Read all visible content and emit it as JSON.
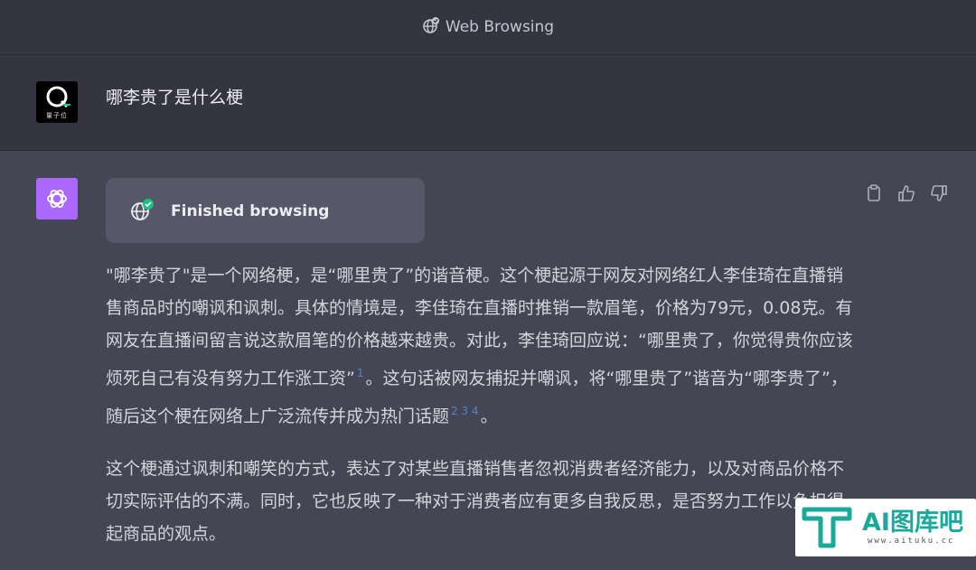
{
  "header": {
    "title": "Web Browsing",
    "icon": "globe-plugin-icon"
  },
  "user_message": {
    "avatar_caption": "量子位",
    "text": "哪李贵了是什么梗"
  },
  "assistant": {
    "browse_status": "Finished browsing",
    "actions": [
      "copy-icon",
      "thumbs-up-icon",
      "thumbs-down-icon"
    ],
    "p1": {
      "a": "\"哪李贵了\"是一个网络梗，是“哪里贵了”的谐音梗。这个梗起源于网友对网络红人李佳琦在直播销售商品时的嘲讽和讽刺。具体的情境是，李佳琦在直播时推销一款眉笔，价格为79元，0.08克。有网友在直播间留言说这款眉笔的价格越来越贵。对此，李佳琦回应说：“哪里贵了，你觉得贵你应该烦死自己有没有努力工作涨工资”",
      "ref1": "1",
      "b": "。这句话被网友捕捉并嘲讽，将“哪里贵了”谐音为“哪李贵了”，随后这个梗在网络上广泛流传并成为热门话题",
      "refs": "2 3 4",
      "c": "。"
    },
    "p2": "这个梗通过讽刺和嘲笑的方式，表达了对某些直播销售者忽视消费者经济能力，以及对商品价格不切实际评估的不满。同时，它也反映了一种对于消费者应有更多自我反思，是否努力工作以负担得起商品的观点。"
  },
  "watermark": {
    "text": "AI图库吧",
    "url": "www.aituku.cc"
  },
  "colors": {
    "header_bg": "#343541",
    "assistant_bg": "#444654",
    "gpt_avatar": "#ab68ff",
    "card_bg": "#565869"
  }
}
